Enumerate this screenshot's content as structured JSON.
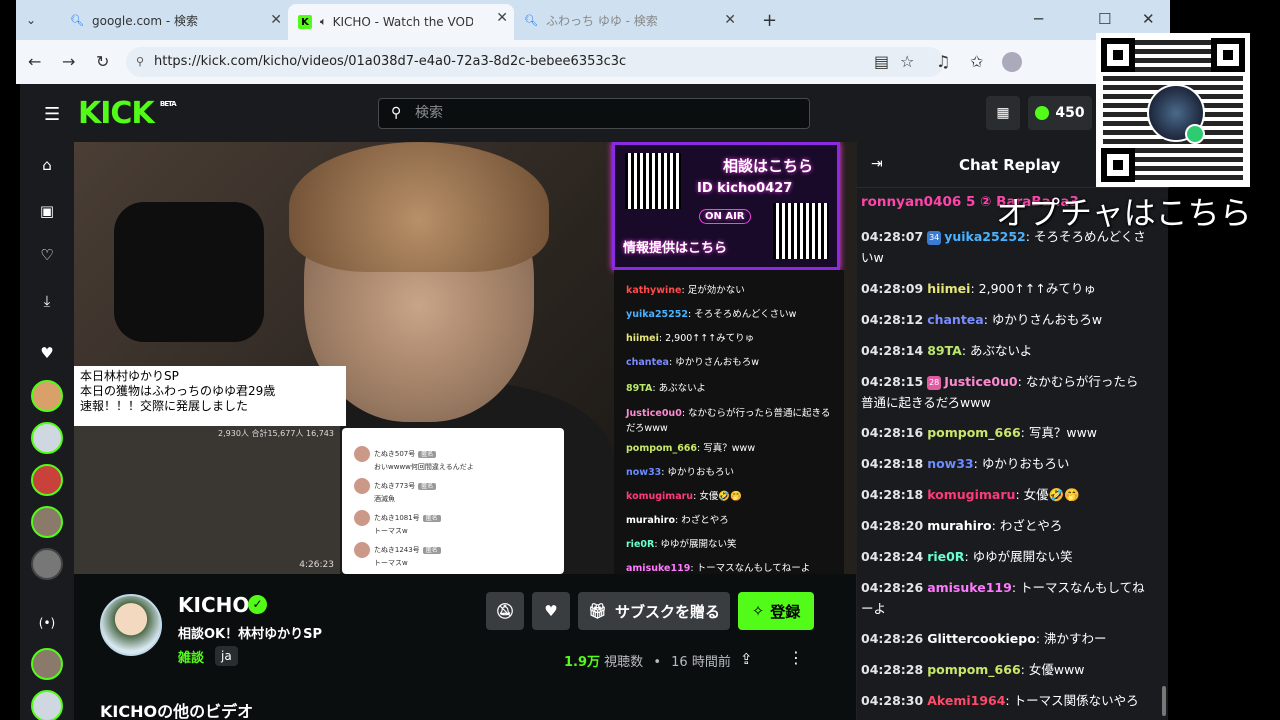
{
  "browser": {
    "tabs": [
      {
        "title": "google.com - 検索"
      },
      {
        "title": "KICHO - Watch the VOD on Ki"
      },
      {
        "title": "ふわっち ゆゆ - 検索"
      }
    ],
    "url": "https://kick.com/kicho/videos/01a038d7-e4a0-72a3-8d2c-bebee6353c3c"
  },
  "header": {
    "logo": "KICK",
    "logo_badge": "BETA",
    "search_placeholder": "検索",
    "points": "450"
  },
  "video_overlay": {
    "caption": [
      "本日林村ゆかりSP",
      "本日の獲物はふわっちのゆゆ君29歳",
      "速報！！！交際に発展しました"
    ],
    "inset_stats": "2,930人 合計15,677人  16,743",
    "inset_time": "4:26:23",
    "comments": [
      {
        "name": "たぬき507号",
        "tag": "匿名",
        "text": "おいwwww何回間違えるんだよ"
      },
      {
        "name": "たぬき773号",
        "tag": "匿名",
        "text": "酒滅魚"
      },
      {
        "name": "たぬき1081号",
        "tag": "匿名",
        "text": "トーマスw"
      },
      {
        "name": "たぬき1243号",
        "tag": "匿名",
        "text": "トーマスw"
      }
    ],
    "panel_consult": "相談はこちら",
    "panel_id": "ID  kicho0427",
    "panel_onair": "ON AIR",
    "panel_info": "情報提供はこちら",
    "stream_chat": [
      {
        "user": "kathywine",
        "color": "#ff4b4b",
        "text": "足が効かない"
      },
      {
        "user": "yuika25252",
        "color": "#4ab3ff",
        "text": "そろそろめんどくさいw"
      },
      {
        "user": "hiimei",
        "color": "#e6e67a",
        "text": "2,900↑↑↑みてりゅ"
      },
      {
        "user": "chantea",
        "color": "#7a8cff",
        "text": "ゆかりさんおもろw"
      },
      {
        "user": "89TA",
        "color": "#b9e86a",
        "text": "あぶないよ"
      },
      {
        "user": "Justice0u0",
        "color": "#ff8ad0",
        "text": "なかむらが行ったら普通に起きるだろwww"
      },
      {
        "user": "pompom_666",
        "color": "#c9e86a",
        "text": "写真？www"
      },
      {
        "user": "now33",
        "color": "#6a8cff",
        "text": "ゆかりおもろい"
      },
      {
        "user": "komugimaru",
        "color": "#ff3a7a",
        "text": "女優🤣🤭"
      },
      {
        "user": "murahiro",
        "color": "#ffffff",
        "text": "わざとやろ"
      },
      {
        "user": "rie0R",
        "color": "#6affd0",
        "text": "ゆゆが展開ない笑"
      },
      {
        "user": "amisuke119",
        "color": "#ff7aff",
        "text": "トーマスなんもしてねーよ"
      }
    ]
  },
  "channel": {
    "name": "KICHO",
    "title": "相談OK！林村ゆかりSP",
    "category": "雑談",
    "language": "ja",
    "views_num": "1.9万",
    "views_label": "視聴数",
    "age": "16 時間前",
    "gift_label": "サブスクを贈る",
    "follow_label": "登録",
    "more_videos": "KICHOの他のビデオ"
  },
  "chat": {
    "title": "Chat Replay",
    "pinned": "ronnyan0406 5   ② BaraBana3",
    "messages": [
      {
        "ts": "04:28:07",
        "badge": "34",
        "badge_color": "#3a7bd5",
        "user": "yuika25252",
        "color": "#4ab3ff",
        "text": "そろそろめんどくさいw"
      },
      {
        "ts": "04:28:09",
        "badge": "",
        "user": "hiimei",
        "color": "#e6e67a",
        "text": "2,900↑↑↑みてりゅ"
      },
      {
        "ts": "04:28:12",
        "badge": "",
        "user": "chantea",
        "color": "#7a8cff",
        "text": "ゆかりさんおもろw"
      },
      {
        "ts": "04:28:14",
        "badge": "",
        "user": "89TA",
        "color": "#b9e86a",
        "text": "あぶないよ"
      },
      {
        "ts": "04:28:15",
        "badge": "28",
        "badge_color": "#e05aa0",
        "user": "Justice0u0",
        "color": "#ff8ad0",
        "text": "なかむらが行ったら普通に起きるだろwww"
      },
      {
        "ts": "04:28:16",
        "badge": "",
        "user": "pompom_666",
        "color": "#c9e86a",
        "text": "写真？www"
      },
      {
        "ts": "04:28:18",
        "badge": "",
        "user": "now33",
        "color": "#6a8cff",
        "text": "ゆかりおもろい"
      },
      {
        "ts": "04:28:18",
        "badge": "",
        "user": "komugimaru",
        "color": "#ff3a7a",
        "text": "女優🤣🤭"
      },
      {
        "ts": "04:28:20",
        "badge": "",
        "user": "murahiro",
        "color": "#ffffff",
        "text": "わざとやろ"
      },
      {
        "ts": "04:28:24",
        "badge": "",
        "user": "rie0R",
        "color": "#6affd0",
        "text": "ゆゆが展開ない笑"
      },
      {
        "ts": "04:28:26",
        "badge": "",
        "user": "amisuke119",
        "color": "#ff7aff",
        "text": "トーマスなんもしてねーよ"
      },
      {
        "ts": "04:28:26",
        "badge": "",
        "user": "Glittercookiepo",
        "color": "#ffffff",
        "text": "沸かすわー"
      },
      {
        "ts": "04:28:28",
        "badge": "",
        "user": "pompom_666",
        "color": "#c9e86a",
        "text": "女優www"
      },
      {
        "ts": "04:28:30",
        "badge": "",
        "user": "Akemi1964",
        "color": "#ff4b6a",
        "text": "トーマス関係ないやろ"
      }
    ]
  },
  "qr_overlay": {
    "caption": "オプチャはこちら"
  }
}
